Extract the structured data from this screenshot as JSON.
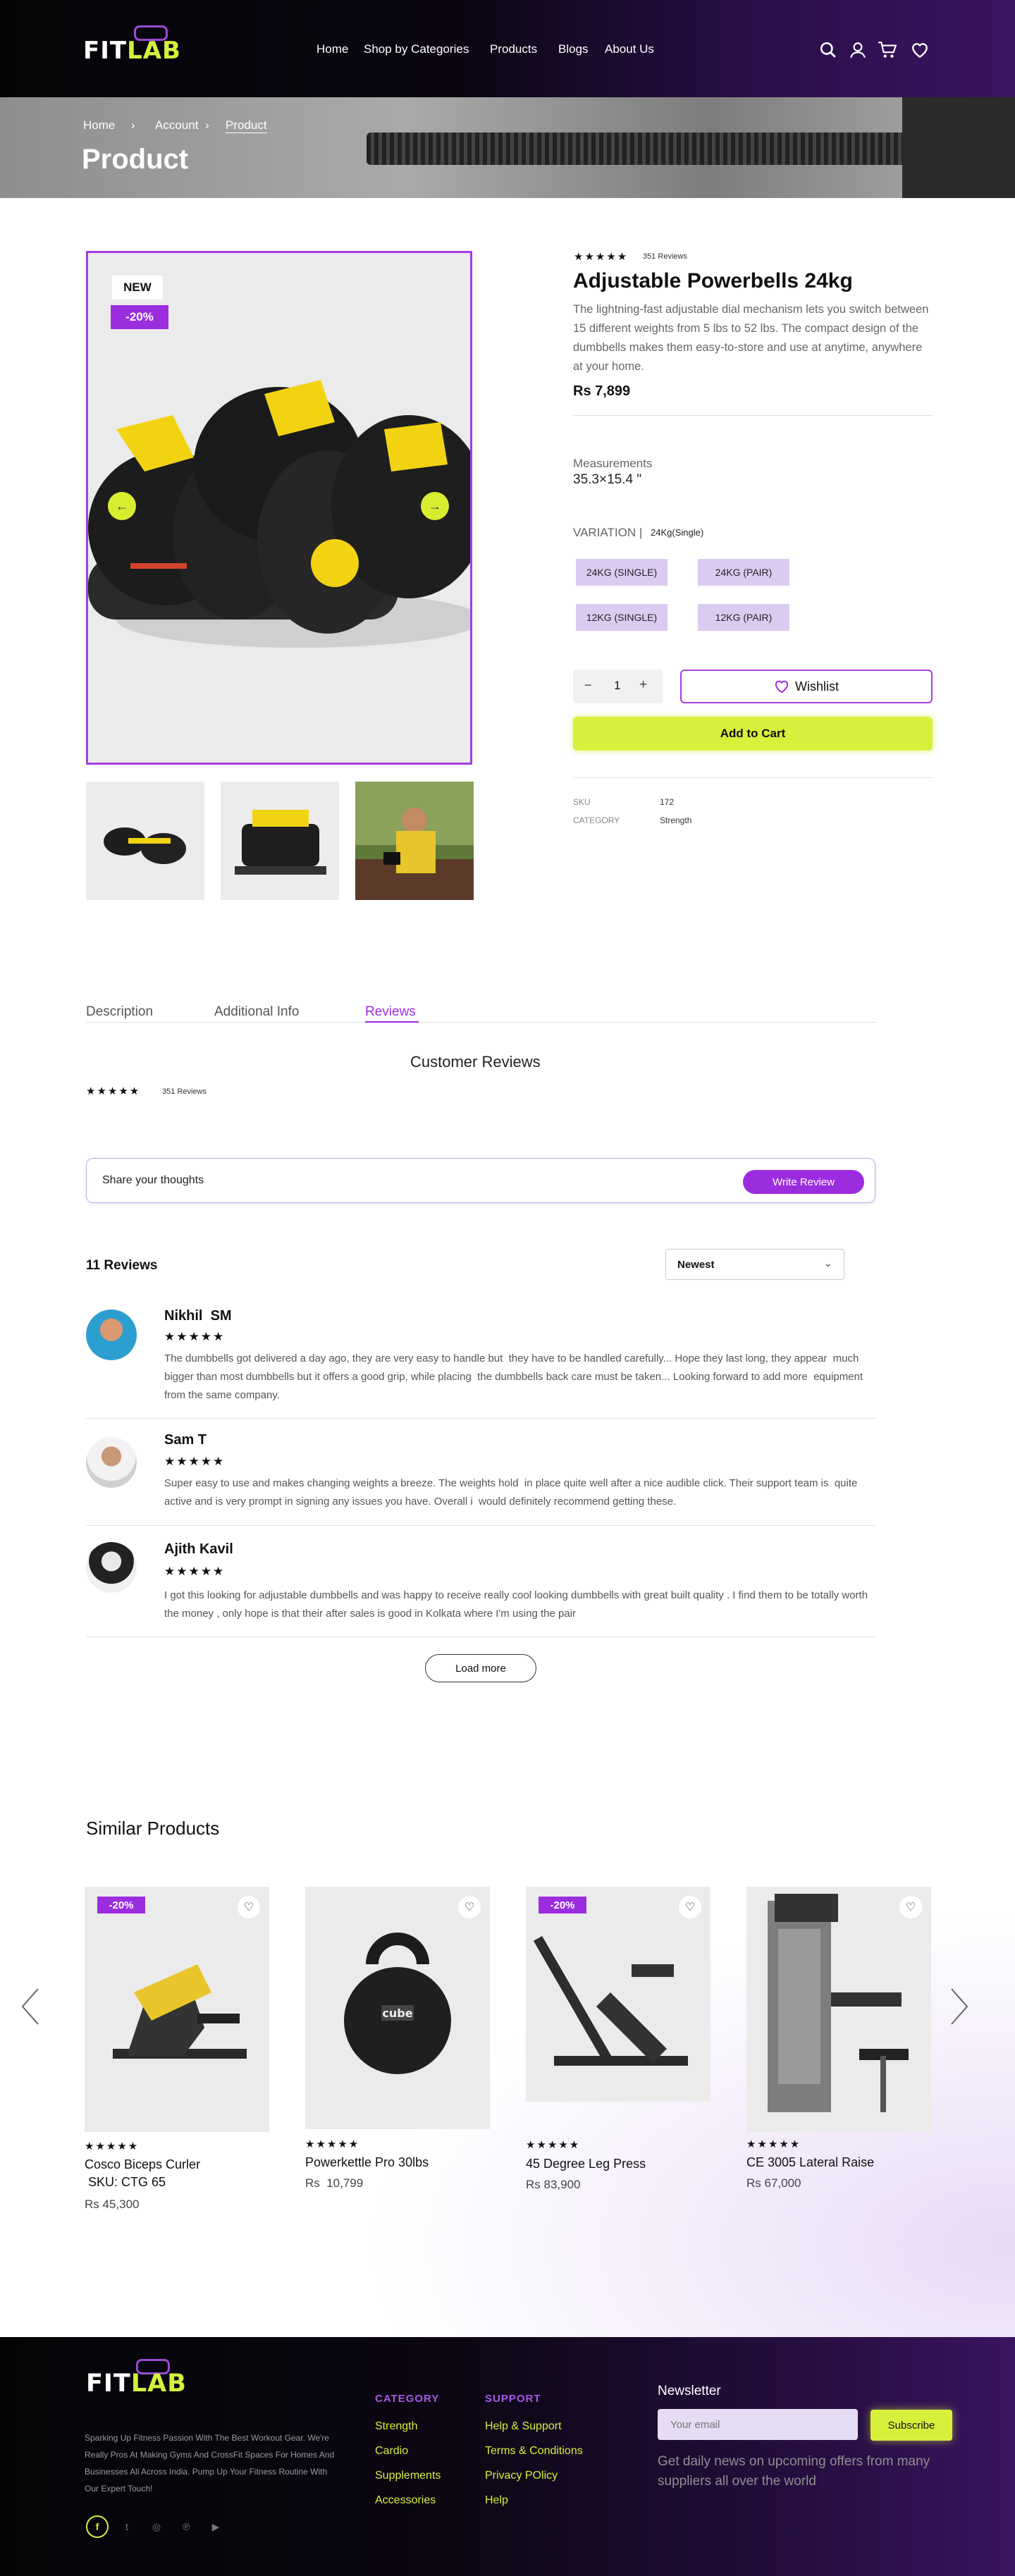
{
  "brand": {
    "fit": "FIT",
    "lab": "LAB"
  },
  "nav": {
    "home": "Home",
    "categories": "Shop by Categories",
    "products": "Products",
    "blogs": "Blogs",
    "about": "About Us"
  },
  "header_icons": [
    "search-icon",
    "user-icon",
    "cart-icon",
    "heart-icon"
  ],
  "breadcrumb": {
    "home": "Home",
    "account": "Account",
    "product": "Product"
  },
  "banner": {
    "title": "Product"
  },
  "product": {
    "badge_new": "NEW",
    "badge_discount": "-20%",
    "review_count": "351 Reviews",
    "rating": 5,
    "title": "Adjustable Powerbells 24kg",
    "description": "The lightning-fast adjustable dial mechanism lets you switch between 15 different weights from 5 lbs to 52 lbs. The compact design of the dumbbells makes them easy-to-store and use at anytime, anywhere at your home.",
    "price": "Rs 7,899",
    "measurements_label": "Measurements",
    "measurements_value": "35.3×15.4 \"",
    "variation_label": "VARIATION",
    "variation_selected": "24Kg(Single)",
    "variations": [
      "24KG (SINGLE)",
      "24KG (PAIR)",
      "12KG (SINGLE)",
      "12KG (PAIR)"
    ],
    "quantity": "1",
    "qty_minus": "−",
    "qty_plus": "+",
    "wishlist_label": "Wishlist",
    "add_to_cart": "Add to Cart",
    "sku_label": "SKU",
    "sku_value": "172",
    "category_label": "CATEGORY",
    "category_value": "Strength"
  },
  "tabs": {
    "description": "Description",
    "additional": "Additional Info",
    "reviews": "Reviews"
  },
  "reviews_section": {
    "title": "Customer Reviews",
    "summary_count": "351 Reviews",
    "placeholder": "Share your thoughts",
    "write_button": "Write Review",
    "count_label": "11 Reviews",
    "sort_selected": "Newest",
    "load_more": "Load more",
    "items": [
      {
        "name": "Nikhil  SM",
        "rating": 5,
        "text": "The dumbbells got delivered a day ago, they are very easy to handle but  they have to be handled carefully... Hope they last long, they appear  much bigger than most dumbbells but it offers a good grip, while placing  the dumbbells back care must be taken... Looking forward to add more  equipment from the same company."
      },
      {
        "name": "Sam T",
        "rating": 5,
        "text": "Super easy to use and makes changing weights a breeze. The weights hold  in place quite well after a nice audible click. Their support team is  quite active and is very prompt in signing any issues you have. Overall i  would definitely recommend getting these."
      },
      {
        "name": "Ajith Kavil",
        "rating": 5,
        "text": "I got this looking for adjustable dumbbells and was happy to receive really cool looking dumbbells with great built quality . I find them to be totally worth the money , only hope is that their after sales is good in Kolkata where I'm using the pair"
      }
    ]
  },
  "similar": {
    "title": "Similar Products",
    "items": [
      {
        "badge": "-20%",
        "rating": 5,
        "title": "Cosco Biceps Curler",
        "subtitle": " SKU: CTG 65",
        "price": "Rs 45,300"
      },
      {
        "badge": "",
        "rating": 5,
        "title": "Powerkettle Pro 30lbs",
        "subtitle": "",
        "price": "Rs  10,799"
      },
      {
        "badge": "-20%",
        "rating": 5,
        "title": "45 Degree Leg Press",
        "subtitle": "",
        "price": "Rs 83,900"
      },
      {
        "badge": "",
        "rating": 5,
        "title": "CE 3005 Lateral Raise",
        "subtitle": "",
        "price": "Rs 67,000"
      }
    ]
  },
  "footer": {
    "tagline": "Sparking Up Fitness Passion With The Best Workout Gear. We're Really Pros At Making Gyms And CrossFit Spaces For Homes And Businesses All  Across India. Pump Up Your Fitness Routine With Our Expert Touch!",
    "category_heading": "CATEGORY",
    "categories": [
      "Strength",
      "Cardio",
      "Supplements",
      "Accessories"
    ],
    "support_heading": "SUPPORT",
    "support": [
      "Help & Support",
      "Terms & Conditions",
      "Privacy POlicy",
      "Help"
    ],
    "newsletter_title": "Newsletter",
    "email_placeholder": "Your email",
    "subscribe": "Subscribe",
    "newsletter_text": "Get daily news on upcoming offers from many suppliers all over the world",
    "social_icons": [
      "facebook-icon",
      "twitter-icon",
      "instagram-icon",
      "pinterest-icon",
      "youtube-icon"
    ]
  },
  "colors": {
    "accent": "#9c2ddf",
    "lime": "#d8ef3b",
    "pill": "#dccbf1"
  }
}
